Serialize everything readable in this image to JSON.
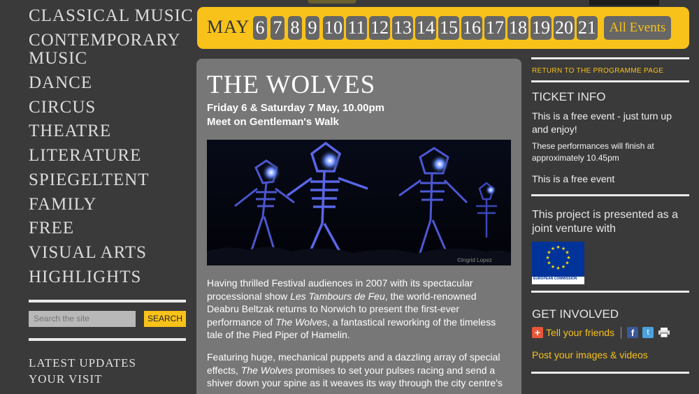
{
  "nav": {
    "items": [
      "CLASSICAL MUSIC",
      "CONTEMPORARY MUSIC",
      "DANCE",
      "CIRCUS",
      "THEATRE",
      "LITERATURE",
      "SPIEGELTENT",
      "FAMILY",
      "FREE",
      "VISUAL ARTS",
      "HIGHLIGHTS"
    ],
    "contemporary_line1": "CONTEMPORARY",
    "contemporary_line2": "MUSIC"
  },
  "search": {
    "placeholder": "Search the site",
    "button_label": "SEARCH"
  },
  "lower_links": [
    "LATEST UPDATES",
    "YOUR VISIT"
  ],
  "datebar": {
    "month": "MAY",
    "days": [
      "6",
      "7",
      "8",
      "9",
      "10",
      "11",
      "12",
      "13",
      "14",
      "15",
      "16",
      "17",
      "18",
      "19",
      "20",
      "21"
    ],
    "all_events_label": "All Events"
  },
  "event": {
    "title": "THE WOLVES",
    "dates": "Friday 6 & Saturday 7 May, 10.00pm",
    "location": "Meet on Gentleman's Walk",
    "photo_credit": "©Ingrid Lopez",
    "para1_a": "Having thrilled Festival audiences in 2007 with its spectacular processional show ",
    "para1_em": "Les Tambours de Feu",
    "para1_b": ", the world-renowned Deabru Beltzak returns to Norwich to present the first-ever performance of ",
    "para1_em2": "The Wolves",
    "para1_c": ", a fantastical reworking of the timeless tale of the Pied Piper of Hamelin.",
    "para2_a": "Featuring huge, mechanical puppets and a dazzling array of special effects, ",
    "para2_em": "The Wolves",
    "para2_b": " promises to set your pulses racing and send a shiver down your spine as it weaves its way through the city centre's"
  },
  "sidebar_right": {
    "return_link": "RETURN TO THE PROGRAMME PAGE",
    "ticket_heading": "TICKET INFO",
    "ticket_free": "This is a free event - just turn up and enjoy!",
    "finish_note": "These performances will finish at approximately 10.45pm",
    "free_event": "This is a free event",
    "project_text": "This project is presented as a joint venture with",
    "eu_caption": "EUROPEAN COMMISSION",
    "get_involved_heading": "GET INVOLVED",
    "tell_friends": "Tell your friends",
    "post_media": "Post your images & videos"
  },
  "colors": {
    "accent": "#f8c21a",
    "background": "#3a3a3a",
    "panel": "#777777",
    "day_box": "#666666",
    "eu_blue": "#003399"
  }
}
